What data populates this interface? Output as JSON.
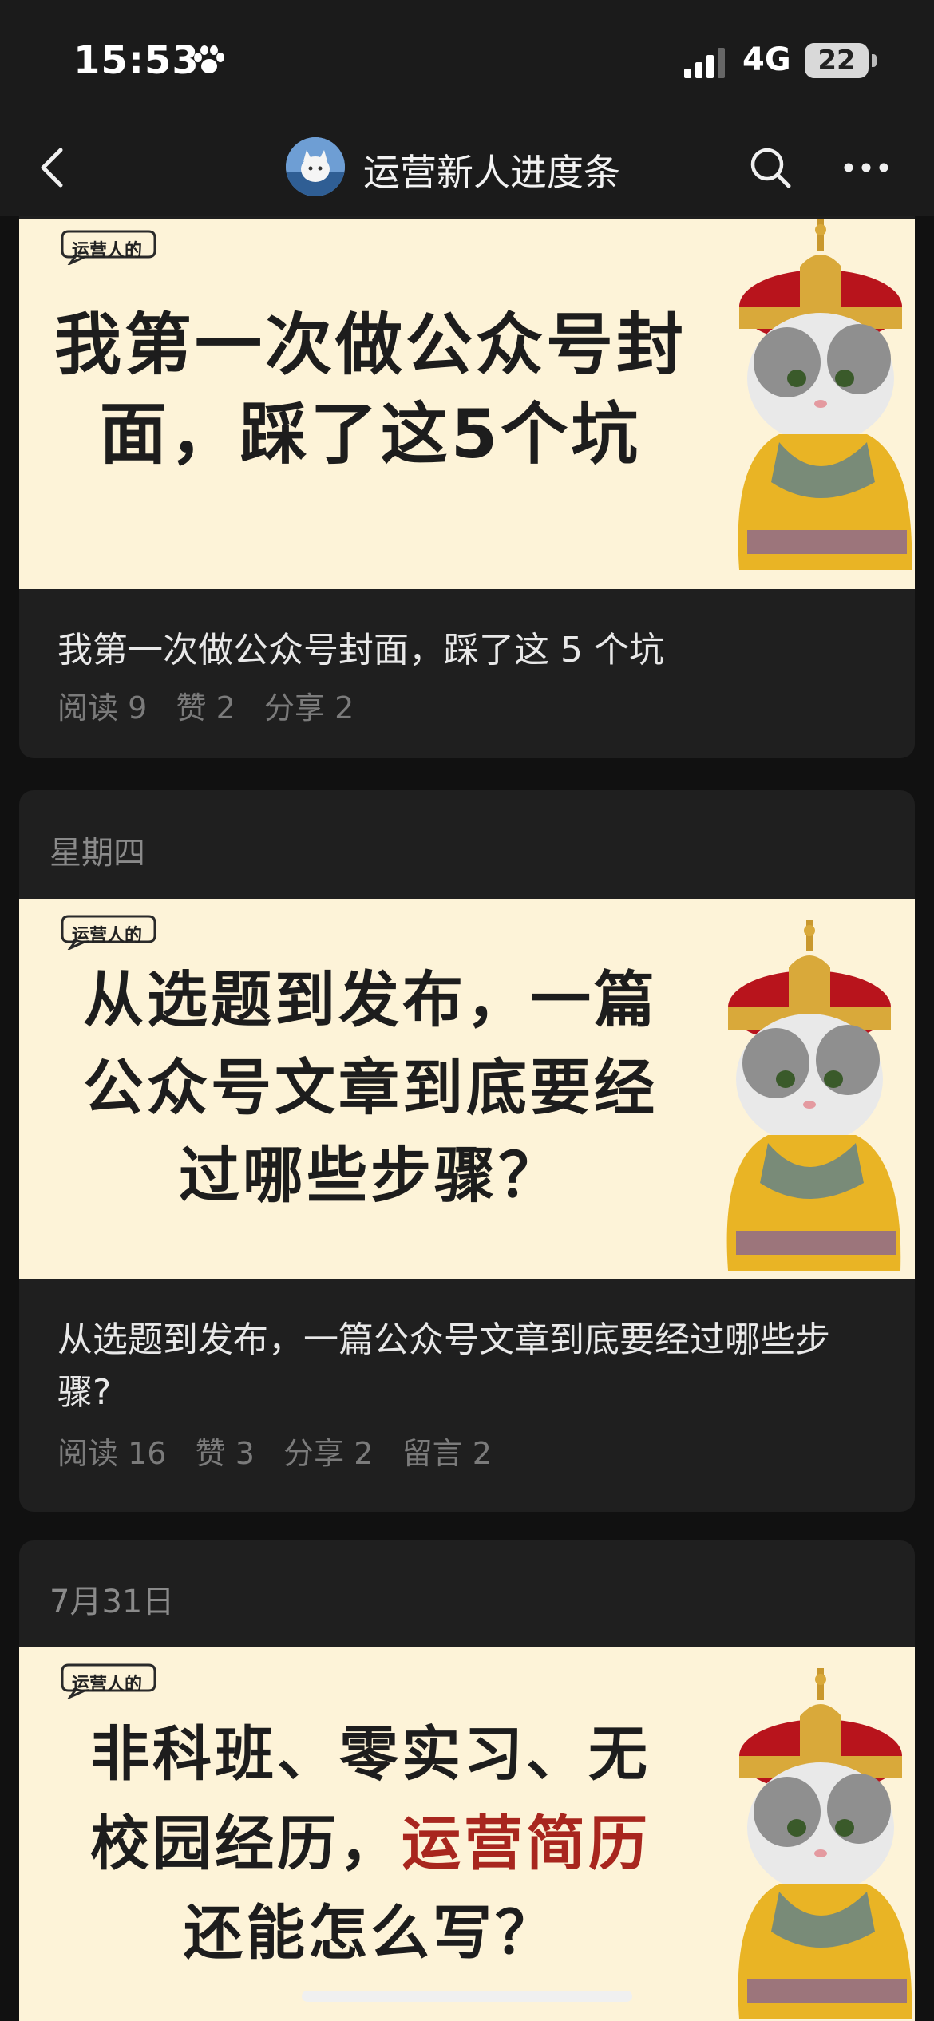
{
  "status": {
    "time": "15:53",
    "network": "4G",
    "battery": "22"
  },
  "nav": {
    "title": "运营新人进度条"
  },
  "cover_tag": "运营人的",
  "articles": [
    {
      "cover_lines": [
        "我第一次做公众号封",
        "面，踩了这5个坑"
      ],
      "title": "我第一次做公众号封面，踩了这 5 个坑",
      "stats": "阅读 9   赞 2   分享 2"
    },
    {
      "date": "星期四",
      "cover_lines": [
        "从选题到发布，一篇",
        "公众号文章到底要经",
        "过哪些步骤？"
      ],
      "title": "从选题到发布，一篇公众号文章到底要经过哪些步骤?",
      "stats": "阅读 16   赞 3   分享 2   留言 2"
    },
    {
      "date": "7月31日",
      "cover_lines": [
        "非科班、零实习、无",
        "校园经历，",
        "运营简历",
        "还能怎么写？"
      ]
    }
  ]
}
